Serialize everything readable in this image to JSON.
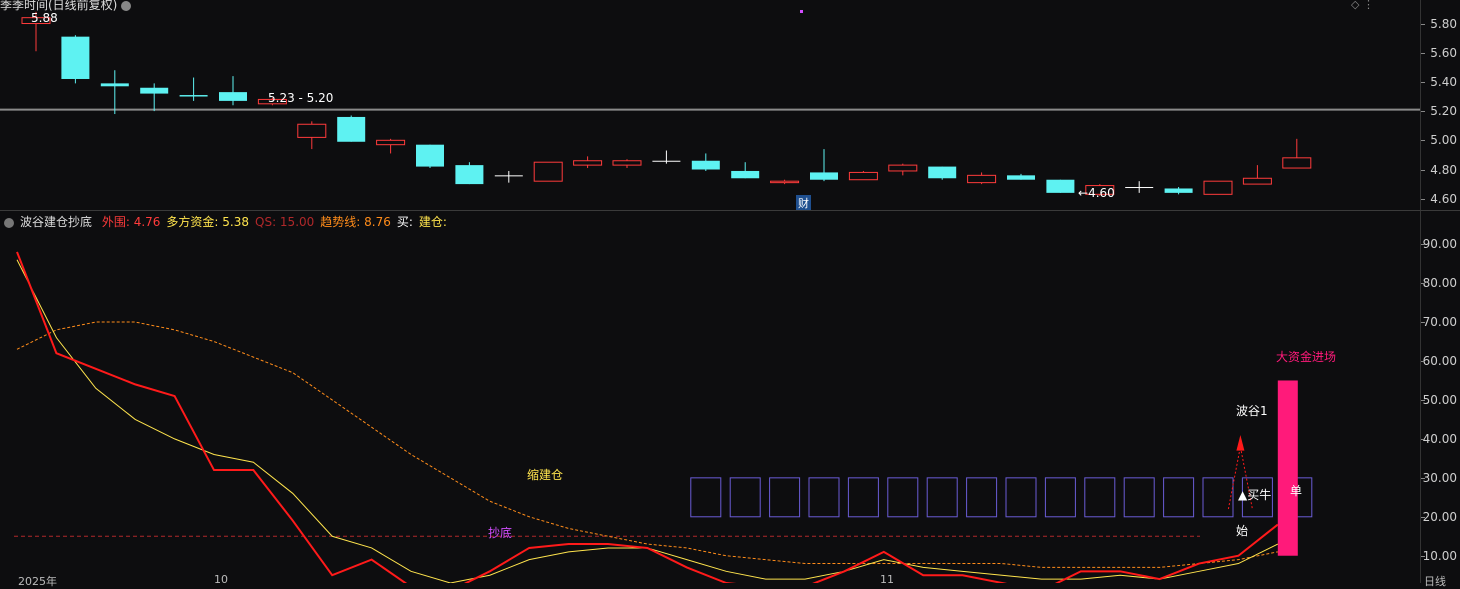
{
  "kline": {
    "title": "季季时间(日线前复权)",
    "price_labels": {
      "high": "5.88",
      "low": "4.60",
      "gap": "5.23 - 5.20",
      "fin_marker": "财"
    },
    "y_ticks": [
      "5.80",
      "5.60",
      "5.40",
      "5.20",
      "5.00",
      "4.80",
      "4.60"
    ],
    "y_range": [
      4.55,
      5.92
    ],
    "hline_price": 5.21,
    "candles": [
      {
        "o": 5.8,
        "c": 5.84,
        "h": 5.88,
        "l": 5.61
      },
      {
        "o": 5.71,
        "c": 5.42,
        "h": 5.72,
        "l": 5.39
      },
      {
        "o": 5.39,
        "c": 5.37,
        "h": 5.48,
        "l": 5.18
      },
      {
        "o": 5.36,
        "c": 5.32,
        "h": 5.39,
        "l": 5.2
      },
      {
        "o": 5.31,
        "c": 5.3,
        "h": 5.43,
        "l": 5.27
      },
      {
        "o": 5.33,
        "c": 5.27,
        "h": 5.44,
        "l": 5.24
      },
      {
        "o": 5.25,
        "c": 5.28,
        "h": 5.29,
        "l": 5.24
      },
      {
        "o": 5.02,
        "c": 5.11,
        "h": 5.13,
        "l": 4.94
      },
      {
        "o": 5.16,
        "c": 4.99,
        "h": 5.17,
        "l": 4.99
      },
      {
        "o": 4.97,
        "c": 5.0,
        "h": 5.01,
        "l": 4.91
      },
      {
        "o": 4.97,
        "c": 4.82,
        "h": 4.97,
        "l": 4.81
      },
      {
        "o": 4.83,
        "c": 4.7,
        "h": 4.85,
        "l": 4.7
      },
      {
        "o": 4.76,
        "c": 4.76,
        "h": 4.79,
        "l": 4.71
      },
      {
        "o": 4.72,
        "c": 4.85,
        "h": 4.85,
        "l": 4.72
      },
      {
        "o": 4.83,
        "c": 4.86,
        "h": 4.89,
        "l": 4.81
      },
      {
        "o": 4.83,
        "c": 4.86,
        "h": 4.87,
        "l": 4.81
      },
      {
        "o": 4.86,
        "c": 4.86,
        "h": 4.93,
        "l": 4.84
      },
      {
        "o": 4.86,
        "c": 4.8,
        "h": 4.91,
        "l": 4.79
      },
      {
        "o": 4.79,
        "c": 4.74,
        "h": 4.85,
        "l": 4.74
      },
      {
        "o": 4.71,
        "c": 4.72,
        "h": 4.73,
        "l": 4.7
      },
      {
        "o": 4.78,
        "c": 4.73,
        "h": 4.94,
        "l": 4.72
      },
      {
        "o": 4.73,
        "c": 4.78,
        "h": 4.79,
        "l": 4.73
      },
      {
        "o": 4.79,
        "c": 4.83,
        "h": 4.84,
        "l": 4.76
      },
      {
        "o": 4.82,
        "c": 4.74,
        "h": 4.82,
        "l": 4.73
      },
      {
        "o": 4.71,
        "c": 4.76,
        "h": 4.78,
        "l": 4.7
      },
      {
        "o": 4.76,
        "c": 4.73,
        "h": 4.77,
        "l": 4.73
      },
      {
        "o": 4.73,
        "c": 4.64,
        "h": 4.73,
        "l": 4.64
      },
      {
        "o": 4.63,
        "c": 4.69,
        "h": 4.7,
        "l": 4.62
      },
      {
        "o": 4.68,
        "c": 4.68,
        "h": 4.72,
        "l": 4.64
      },
      {
        "o": 4.67,
        "c": 4.64,
        "h": 4.68,
        "l": 4.63
      },
      {
        "o": 4.63,
        "c": 4.72,
        "h": 4.72,
        "l": 4.63
      },
      {
        "o": 4.7,
        "c": 4.74,
        "h": 4.83,
        "l": 4.7
      },
      {
        "o": 4.81,
        "c": 4.88,
        "h": 5.01,
        "l": 4.81
      }
    ],
    "colors": {
      "up": "#ff3b3b",
      "down": "#5ef2f2",
      "doji": "#ffffff"
    }
  },
  "indicator": {
    "name": "波谷建仓抄底",
    "params": [
      {
        "label": "外围: 4.76",
        "color": "#ff3b3b"
      },
      {
        "label": "多方资金: 5.38",
        "color": "#ffe44d"
      },
      {
        "label": "QS: 15.00",
        "color": "#b0282a"
      },
      {
        "label": "趋势线: 8.76",
        "color": "#ff8c1a"
      },
      {
        "label": "买:",
        "color": "#ffffff"
      },
      {
        "label": "建仓:",
        "color": "#ffe44d"
      }
    ],
    "y_ticks": [
      "90.00",
      "80.00",
      "70.00",
      "60.00",
      "50.00",
      "40.00",
      "30.00",
      "20.00",
      "10.00"
    ],
    "y_range": [
      3,
      98
    ],
    "annotations": {
      "big_money": "大资金进场",
      "wave_valley": "波谷1",
      "buy": "▲买牛",
      "start": "始",
      "build": "缩建仓",
      "bottom": "抄底",
      "side": "单"
    },
    "series_red": [
      88,
      62,
      58,
      54,
      51,
      32,
      32,
      19,
      5,
      9,
      2,
      1,
      6,
      12,
      13,
      13,
      12,
      7,
      3,
      2,
      2,
      6,
      11,
      5,
      5,
      3,
      1,
      6,
      6,
      4,
      8,
      10,
      18
    ],
    "series_yellow": [
      86,
      66,
      53,
      45,
      40,
      36,
      34,
      26,
      15,
      12,
      6,
      3,
      5,
      9,
      11,
      12,
      12,
      9,
      6,
      4,
      4,
      6,
      9,
      7,
      6,
      5,
      4,
      4,
      5,
      4,
      6,
      8,
      13
    ],
    "series_orange": [
      63,
      68,
      70,
      70,
      68,
      65,
      61,
      57,
      50,
      43,
      36,
      30,
      24,
      20,
      17,
      15,
      13,
      12,
      10,
      9,
      8,
      8,
      8,
      8,
      8,
      8,
      7,
      7,
      7,
      7,
      8,
      9,
      11
    ],
    "qs_level": 15,
    "big_bar": [
      10,
      55
    ],
    "box_range": [
      20,
      30
    ],
    "colors": {
      "red": "#ff1a1a",
      "yellow": "#ffe44d",
      "orange": "#ff8c1a",
      "qs": "#b0282a",
      "box": "#6a5cd6",
      "magenta": "#ff1a7a"
    }
  },
  "x_labels": [
    "2025年",
    "10",
    "11"
  ],
  "period": "日线"
}
